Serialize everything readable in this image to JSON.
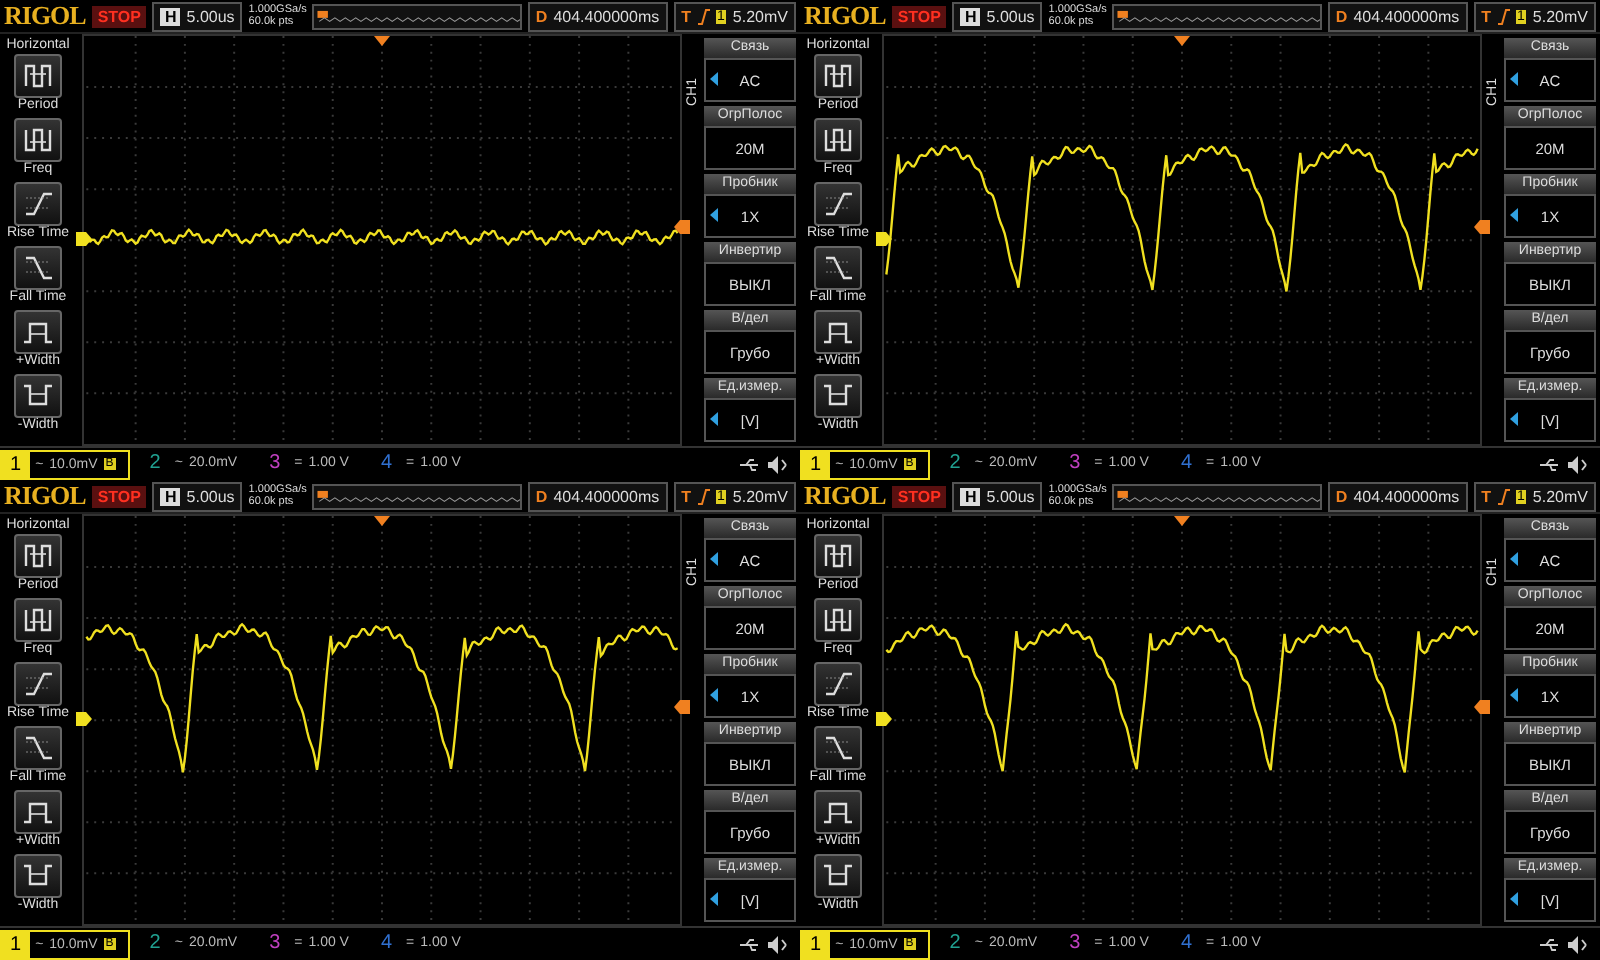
{
  "panels": [
    {
      "brand": "RIGOL",
      "status": "STOP",
      "timebase_label": "H",
      "timebase": "5.00us",
      "sample_rate": "1.000GSa/s",
      "memory": "60.0k pts",
      "delay_label": "D",
      "delay": "404.400000ms",
      "trigger_label": "T",
      "trigger_source": "1",
      "trigger_level": "5.20mV",
      "measure_title": "Horizontal",
      "measures": [
        {
          "kind": "period",
          "label": "Period"
        },
        {
          "kind": "freq",
          "label": "Freq"
        },
        {
          "kind": "rise",
          "label": "Rise Time"
        },
        {
          "kind": "fall",
          "label": "Fall Time"
        },
        {
          "kind": "pwidth",
          "label": "+Width"
        },
        {
          "kind": "nwidth",
          "label": "-Width"
        }
      ],
      "channel_label": "CH1",
      "menu": [
        {
          "title": "Связь",
          "value": "AC",
          "arrow": true
        },
        {
          "title": "ОгрПолос",
          "value": "20M",
          "arrow": false
        },
        {
          "title": "Пробник",
          "value": "1X",
          "arrow": true
        },
        {
          "title": "Инвертир",
          "value": "ВЫКЛ",
          "arrow": false
        },
        {
          "title": "В/дел",
          "value": "Грубо",
          "arrow": false
        },
        {
          "title": "Ед.измер.",
          "value": "[V]",
          "arrow": true
        }
      ],
      "channels": [
        {
          "number": "1",
          "coupling": "~",
          "scale": "10.0mV",
          "badge": "B",
          "color": "#f0e020",
          "selected": true
        },
        {
          "number": "2",
          "coupling": "~",
          "scale": "20.0mV",
          "color": "#20a090",
          "selected": false
        },
        {
          "number": "3",
          "coupling": "=",
          "scale": "1.00 V",
          "color": "#c040c0",
          "selected": false
        },
        {
          "number": "4",
          "coupling": "=",
          "scale": "1.00 V",
          "color": "#3070d0",
          "selected": false
        }
      ],
      "waveform": {
        "kind": "ripple"
      }
    },
    {
      "brand": "RIGOL",
      "status": "STOP",
      "timebase_label": "H",
      "timebase": "5.00us",
      "sample_rate": "1.000GSa/s",
      "memory": "60.0k pts",
      "delay_label": "D",
      "delay": "404.400000ms",
      "trigger_label": "T",
      "trigger_source": "1",
      "trigger_level": "5.20mV",
      "measure_title": "Horizontal",
      "measures": [
        {
          "kind": "period",
          "label": "Period"
        },
        {
          "kind": "freq",
          "label": "Freq"
        },
        {
          "kind": "rise",
          "label": "Rise Time"
        },
        {
          "kind": "fall",
          "label": "Fall Time"
        },
        {
          "kind": "pwidth",
          "label": "+Width"
        },
        {
          "kind": "nwidth",
          "label": "-Width"
        }
      ],
      "channel_label": "CH1",
      "menu": [
        {
          "title": "Связь",
          "value": "AC",
          "arrow": true
        },
        {
          "title": "ОгрПолос",
          "value": "20M",
          "arrow": false
        },
        {
          "title": "Пробник",
          "value": "1X",
          "arrow": true
        },
        {
          "title": "Инвертир",
          "value": "ВЫКЛ",
          "arrow": false
        },
        {
          "title": "В/дел",
          "value": "Грубо",
          "arrow": false
        },
        {
          "title": "Ед.измер.",
          "value": "[V]",
          "arrow": true
        }
      ],
      "channels": [
        {
          "number": "1",
          "coupling": "~",
          "scale": "10.0mV",
          "badge": "B",
          "color": "#f0e020",
          "selected": true
        },
        {
          "number": "2",
          "coupling": "~",
          "scale": "20.0mV",
          "color": "#20a090",
          "selected": false
        },
        {
          "number": "3",
          "coupling": "=",
          "scale": "1.00 V",
          "color": "#c040c0",
          "selected": false
        },
        {
          "number": "4",
          "coupling": "=",
          "scale": "1.00 V",
          "color": "#3070d0",
          "selected": false
        }
      ],
      "waveform": {
        "kind": "arcs"
      }
    },
    {
      "brand": "RIGOL",
      "status": "STOP",
      "timebase_label": "H",
      "timebase": "5.00us",
      "sample_rate": "1.000GSa/s",
      "memory": "60.0k pts",
      "delay_label": "D",
      "delay": "404.400000ms",
      "trigger_label": "T",
      "trigger_source": "1",
      "trigger_level": "5.20mV",
      "measure_title": "Horizontal",
      "measures": [
        {
          "kind": "period",
          "label": "Period"
        },
        {
          "kind": "freq",
          "label": "Freq"
        },
        {
          "kind": "rise",
          "label": "Rise Time"
        },
        {
          "kind": "fall",
          "label": "Fall Time"
        },
        {
          "kind": "pwidth",
          "label": "+Width"
        },
        {
          "kind": "nwidth",
          "label": "-Width"
        }
      ],
      "channel_label": "CH1",
      "menu": [
        {
          "title": "Связь",
          "value": "AC",
          "arrow": true
        },
        {
          "title": "ОгрПолос",
          "value": "20M",
          "arrow": false
        },
        {
          "title": "Пробник",
          "value": "1X",
          "arrow": true
        },
        {
          "title": "Инвертир",
          "value": "ВЫКЛ",
          "arrow": false
        },
        {
          "title": "В/дел",
          "value": "Грубо",
          "arrow": false
        },
        {
          "title": "Ед.измер.",
          "value": "[V]",
          "arrow": true
        }
      ],
      "channels": [
        {
          "number": "1",
          "coupling": "~",
          "scale": "10.0mV",
          "badge": "B",
          "color": "#f0e020",
          "selected": true
        },
        {
          "number": "2",
          "coupling": "~",
          "scale": "20.0mV",
          "color": "#20a090",
          "selected": false
        },
        {
          "number": "3",
          "coupling": "=",
          "scale": "1.00 V",
          "color": "#c040c0",
          "selected": false
        },
        {
          "number": "4",
          "coupling": "=",
          "scale": "1.00 V",
          "color": "#3070d0",
          "selected": false
        }
      ],
      "waveform": {
        "kind": "arcs"
      }
    },
    {
      "brand": "RIGOL",
      "status": "STOP",
      "timebase_label": "H",
      "timebase": "5.00us",
      "sample_rate": "1.000GSa/s",
      "memory": "60.0k pts",
      "delay_label": "D",
      "delay": "404.400000ms",
      "trigger_label": "T",
      "trigger_source": "1",
      "trigger_level": "5.20mV",
      "measure_title": "Horizontal",
      "measures": [
        {
          "kind": "period",
          "label": "Period"
        },
        {
          "kind": "freq",
          "label": "Freq"
        },
        {
          "kind": "rise",
          "label": "Rise Time"
        },
        {
          "kind": "fall",
          "label": "Fall Time"
        },
        {
          "kind": "pwidth",
          "label": "+Width"
        },
        {
          "kind": "nwidth",
          "label": "-Width"
        }
      ],
      "channel_label": "CH1",
      "menu": [
        {
          "title": "Связь",
          "value": "AC",
          "arrow": true
        },
        {
          "title": "ОгрПолос",
          "value": "20M",
          "arrow": false
        },
        {
          "title": "Пробник",
          "value": "1X",
          "arrow": true
        },
        {
          "title": "Инвертир",
          "value": "ВЫКЛ",
          "arrow": false
        },
        {
          "title": "В/дел",
          "value": "Грубо",
          "arrow": false
        },
        {
          "title": "Ед.измер.",
          "value": "[V]",
          "arrow": true
        }
      ],
      "channels": [
        {
          "number": "1",
          "coupling": "~",
          "scale": "10.0mV",
          "badge": "B",
          "color": "#f0e020",
          "selected": true
        },
        {
          "number": "2",
          "coupling": "~",
          "scale": "20.0mV",
          "color": "#20a090",
          "selected": false
        },
        {
          "number": "3",
          "coupling": "=",
          "scale": "1.00 V",
          "color": "#c040c0",
          "selected": false
        },
        {
          "number": "4",
          "coupling": "=",
          "scale": "1.00 V",
          "color": "#3070d0",
          "selected": false
        }
      ],
      "waveform": {
        "kind": "arcs"
      }
    }
  ]
}
